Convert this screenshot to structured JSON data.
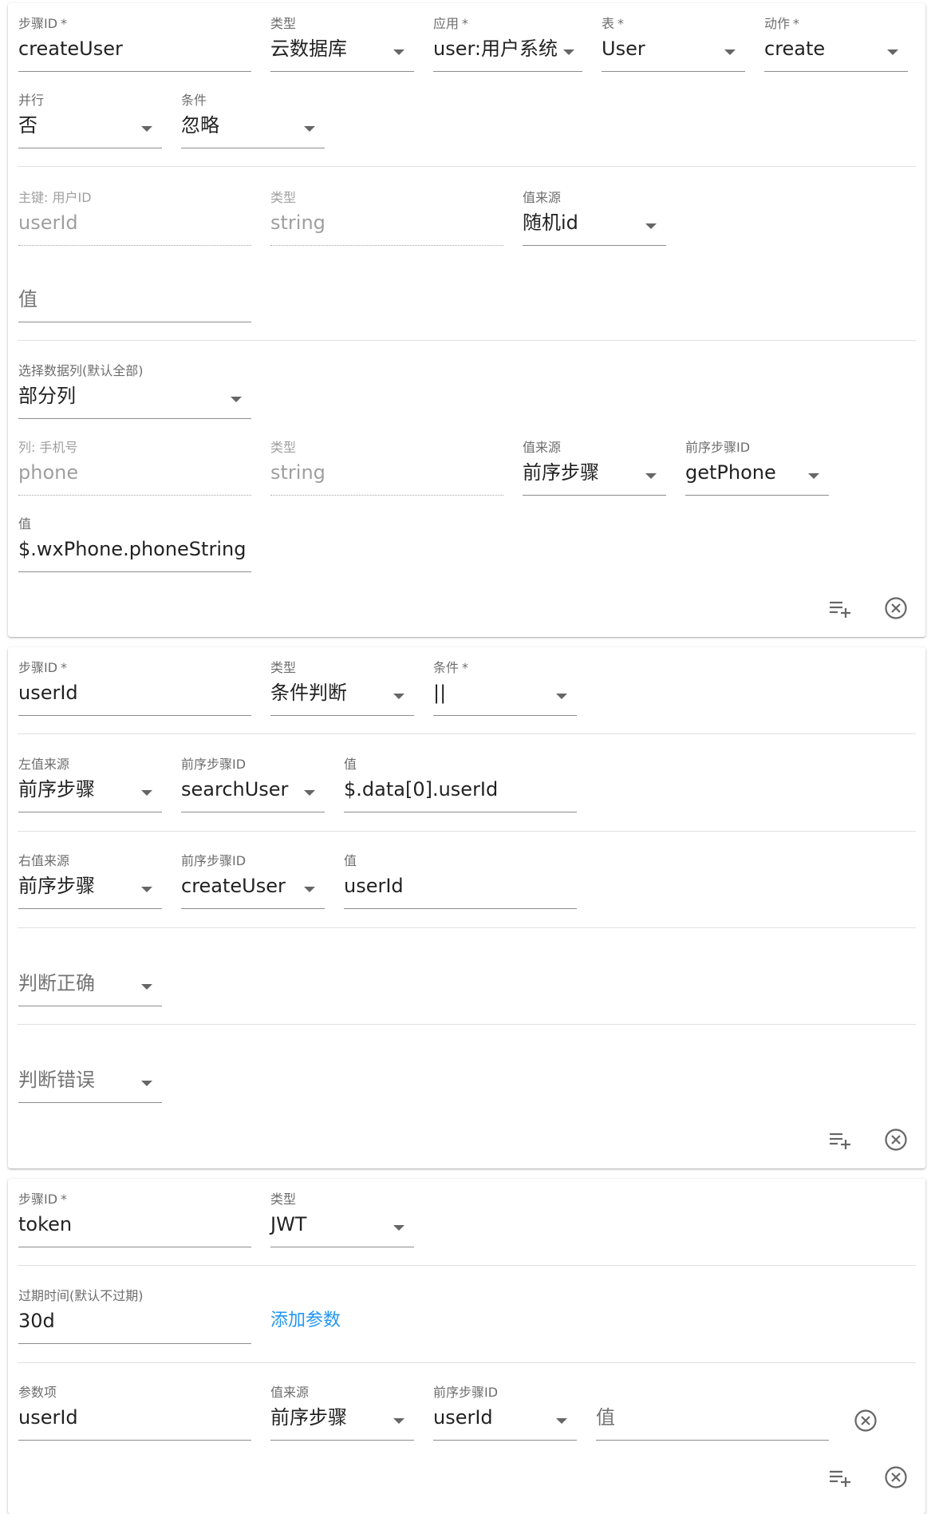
{
  "step1": {
    "step_id": {
      "label": "步骤ID",
      "req": "*",
      "value": "createUser"
    },
    "type": {
      "label": "类型",
      "value": "云数据库"
    },
    "app": {
      "label": "应用",
      "req": "*",
      "value": "user:用户系统"
    },
    "table": {
      "label": "表",
      "req": "*",
      "value": "User"
    },
    "action": {
      "label": "动作",
      "req": "*",
      "value": "create"
    },
    "parallel": {
      "label": "并行",
      "value": "否"
    },
    "condition": {
      "label": "条件",
      "value": "忽略"
    },
    "pk": {
      "label": "主键: 用户ID",
      "value": "userId"
    },
    "pk_type": {
      "label": "类型",
      "value": "string"
    },
    "pk_source": {
      "label": "值来源",
      "value": "随机id"
    },
    "pk_value": {
      "placeholder": "值"
    },
    "columns": {
      "label": "选择数据列(默认全部)",
      "value": "部分列"
    },
    "col": {
      "label": "列: 手机号",
      "value": "phone"
    },
    "col_type": {
      "label": "类型",
      "value": "string"
    },
    "col_source": {
      "label": "值来源",
      "value": "前序步骤"
    },
    "col_prev": {
      "label": "前序步骤ID",
      "value": "getPhone"
    },
    "col_value": {
      "label": "值",
      "value": "$.wxPhone.phoneString"
    }
  },
  "step2": {
    "step_id": {
      "label": "步骤ID",
      "req": "*",
      "value": "userId"
    },
    "type": {
      "label": "类型",
      "value": "条件判断"
    },
    "condition": {
      "label": "条件",
      "req": "*",
      "value": "||"
    },
    "left_source": {
      "label": "左值来源",
      "value": "前序步骤"
    },
    "left_prev": {
      "label": "前序步骤ID",
      "value": "searchUser"
    },
    "left_value": {
      "label": "值",
      "value": "$.data[0].userId"
    },
    "right_source": {
      "label": "右值来源",
      "value": "前序步骤"
    },
    "right_prev": {
      "label": "前序步骤ID",
      "value": "createUser"
    },
    "right_value": {
      "label": "值",
      "value": "userId"
    },
    "on_true": {
      "placeholder": "判断正确"
    },
    "on_false": {
      "placeholder": "判断错误"
    }
  },
  "step3": {
    "step_id": {
      "label": "步骤ID",
      "req": "*",
      "value": "token"
    },
    "type": {
      "label": "类型",
      "value": "JWT"
    },
    "expire": {
      "label": "过期时间(默认不过期)",
      "value": "30d"
    },
    "add_param": "添加参数",
    "param_name": {
      "label": "参数项",
      "value": "userId"
    },
    "param_source": {
      "label": "值来源",
      "value": "前序步骤"
    },
    "param_prev": {
      "label": "前序步骤ID",
      "value": "userId"
    },
    "param_value": {
      "placeholder": "值"
    }
  },
  "icons": {
    "add_step": "playlist-add-icon",
    "remove": "close-circle-icon"
  },
  "colors": {
    "accent": "#2196f3"
  }
}
